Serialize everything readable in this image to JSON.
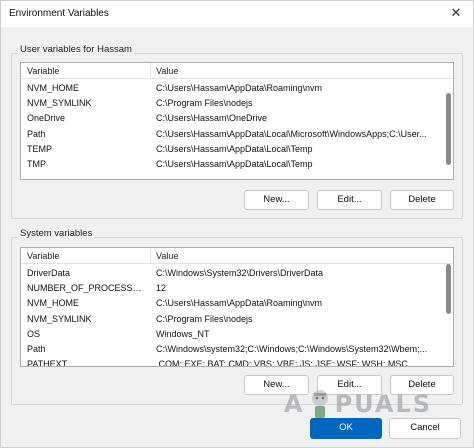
{
  "window": {
    "title": "Environment Variables",
    "close_glyph": "✕"
  },
  "user_vars": {
    "group_label": "User variables for Hassam",
    "columns": [
      "Variable",
      "Value"
    ],
    "rows": [
      {
        "variable": "NVM_HOME",
        "value": "C:\\Users\\Hassam\\AppData\\Roaming\\nvm"
      },
      {
        "variable": "NVM_SYMLINK",
        "value": "C:\\Program Files\\nodejs"
      },
      {
        "variable": "OneDrive",
        "value": "C:\\Users\\Hassam\\OneDrive"
      },
      {
        "variable": "Path",
        "value": "C:\\Users\\Hassam\\AppData\\Local\\Microsoft\\WindowsApps;C:\\User..."
      },
      {
        "variable": "TEMP",
        "value": "C:\\Users\\Hassam\\AppData\\Local\\Temp"
      },
      {
        "variable": "TMP",
        "value": "C:\\Users\\Hassam\\AppData\\Local\\Temp"
      }
    ],
    "buttons": {
      "new": "New...",
      "edit": "Edit...",
      "delete": "Delete"
    }
  },
  "system_vars": {
    "group_label": "System variables",
    "columns": [
      "Variable",
      "Value"
    ],
    "rows": [
      {
        "variable": "DriverData",
        "value": "C:\\Windows\\System32\\Drivers\\DriverData"
      },
      {
        "variable": "NUMBER_OF_PROCESSORS",
        "value": "12"
      },
      {
        "variable": "NVM_HOME",
        "value": "C:\\Users\\Hassam\\AppData\\Roaming\\nvm"
      },
      {
        "variable": "NVM_SYMLINK",
        "value": "C:\\Program Files\\nodejs"
      },
      {
        "variable": "OS",
        "value": "Windows_NT"
      },
      {
        "variable": "Path",
        "value": "C:\\Windows\\system32;C:\\Windows;C:\\Windows\\System32\\Wbem;..."
      },
      {
        "variable": "PATHEXT",
        "value": ".COM;.EXE;.BAT;.CMD;.VBS;.VBE;.JS;.JSE;.WSF;.WSH;.MSC"
      }
    ],
    "buttons": {
      "new": "New...",
      "edit": "Edit...",
      "delete": "Delete"
    }
  },
  "footer": {
    "ok": "OK",
    "cancel": "Cancel"
  },
  "watermark": {
    "left": "A",
    "right": "PUALS"
  },
  "colors": {
    "accent": "#0067c0",
    "window_bg": "#f0f0f0",
    "list_bg": "#ffffff"
  }
}
